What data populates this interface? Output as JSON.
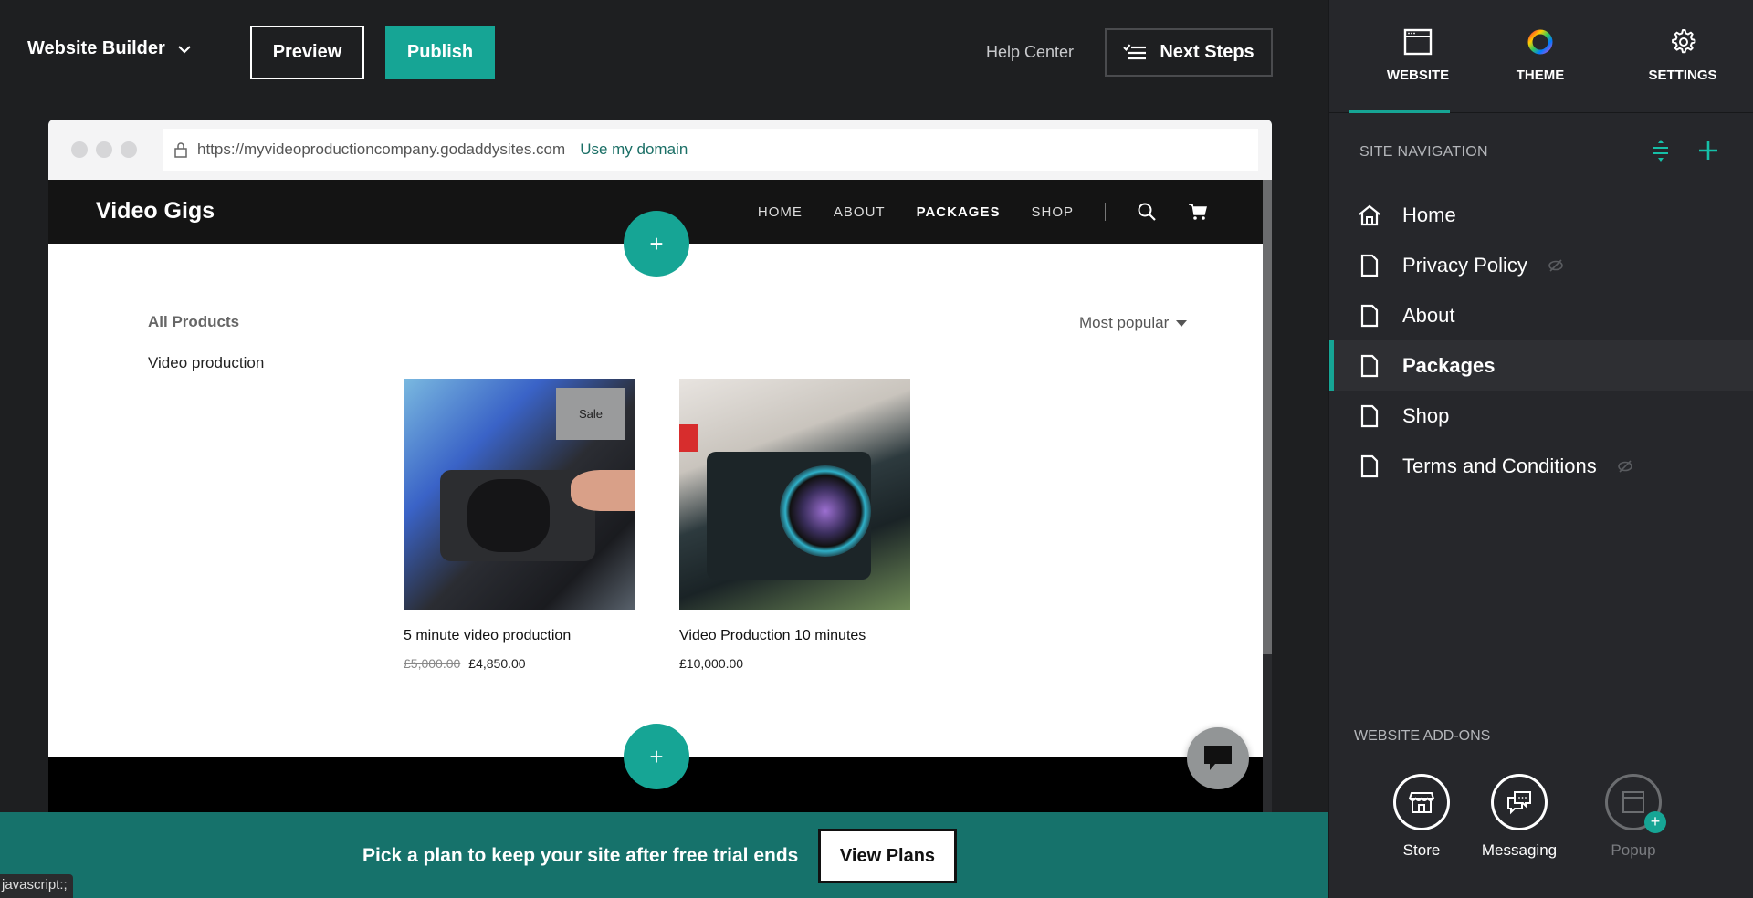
{
  "topbar": {
    "brand": "Website Builder",
    "preview_label": "Preview",
    "publish_label": "Publish",
    "help_label": "Help Center",
    "next_steps_label": "Next Steps"
  },
  "browser": {
    "url": "https://myvideoproductioncompany.godaddysites.com",
    "use_domain_label": "Use my domain"
  },
  "site": {
    "logo": "Video Gigs",
    "nav": [
      "HOME",
      "ABOUT",
      "PACKAGES",
      "SHOP"
    ],
    "active_nav": "PACKAGES",
    "add_section_label": "+",
    "all_products_label": "All Products",
    "category": "Video production",
    "sort_label": "Most popular",
    "products": [
      {
        "name": "5 minute video production",
        "old_price": "£5,000.00",
        "price": "£4,850.00",
        "badge": "Sale"
      },
      {
        "name": "Video Production 10 minutes",
        "price": "£10,000.00"
      }
    ]
  },
  "banner": {
    "text": "Pick a plan to keep your site after free trial ends",
    "button_label": "View Plans"
  },
  "status_tip": "javascript:;",
  "panel": {
    "tabs": [
      {
        "label": "WEBSITE",
        "icon": "browser-window-icon",
        "active": true
      },
      {
        "label": "THEME",
        "icon": "color-wheel-icon",
        "active": false
      },
      {
        "label": "SETTINGS",
        "icon": "gear-icon",
        "active": false
      }
    ],
    "site_navigation_title": "SITE NAVIGATION",
    "pages": [
      {
        "label": "Home",
        "icon": "home-icon",
        "hidden": false,
        "active": false
      },
      {
        "label": "Privacy Policy",
        "icon": "page-icon",
        "hidden": true,
        "active": false
      },
      {
        "label": "About",
        "icon": "page-icon",
        "hidden": false,
        "active": false
      },
      {
        "label": "Packages",
        "icon": "page-icon",
        "hidden": false,
        "active": true
      },
      {
        "label": "Shop",
        "icon": "page-icon",
        "hidden": false,
        "active": false
      },
      {
        "label": "Terms and Conditions",
        "icon": "page-icon",
        "hidden": true,
        "active": false
      }
    ],
    "addons_title": "WEBSITE ADD-ONS",
    "addons": [
      {
        "label": "Store",
        "icon": "store-icon",
        "enabled": true
      },
      {
        "label": "Messaging",
        "icon": "messaging-icon",
        "enabled": true
      },
      {
        "label": "Popup",
        "icon": "popup-icon",
        "enabled": false
      }
    ]
  },
  "colors": {
    "accent": "#16a595",
    "banner": "#16726b",
    "panel_bg": "#26272b",
    "app_bg": "#1e1f21"
  }
}
